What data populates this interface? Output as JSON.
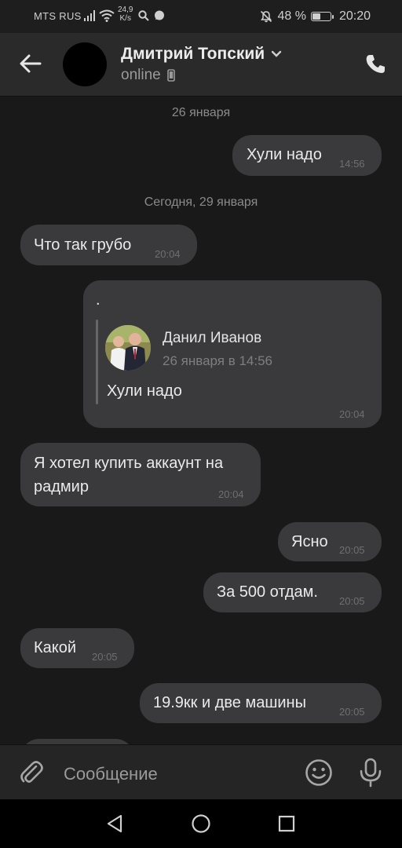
{
  "status_bar": {
    "carrier": "MTS RUS",
    "speed_value": "24,9",
    "speed_unit": "K/s",
    "battery": "48 %",
    "battery_level": 0.48,
    "time": "20:20"
  },
  "header": {
    "contact_name": "Дмитрий Топский",
    "presence": "online"
  },
  "chat": {
    "date_1": "26 января",
    "date_2": "Сегодня, 29 января",
    "messages": [
      {
        "text": "Хули надо",
        "time": "14:56",
        "side": "outgoing"
      },
      {
        "text": "Что так грубо",
        "time": "20:04",
        "side": "incoming"
      },
      {
        "text": ".",
        "time": "20:04",
        "side": "outgoing",
        "reply": {
          "author": "Данил Иванов",
          "date": "26 января в 14:56",
          "text": "Хули надо"
        }
      },
      {
        "line1": "Я хотел купить аккаунт на",
        "line2": "радмир",
        "time": "20:04",
        "side": "incoming"
      },
      {
        "text": "Ясно",
        "time": "20:05",
        "side": "outgoing"
      },
      {
        "text": "За 500 отдам.",
        "time": "20:05",
        "side": "outgoing"
      },
      {
        "text": "Какой",
        "time": "20:05",
        "side": "incoming"
      },
      {
        "text": "19.9кк и две машины",
        "time": "20:05",
        "side": "outgoing"
      }
    ]
  },
  "composer": {
    "placeholder": "Сообщение"
  },
  "colors": {
    "background": "#19191a",
    "bubble": "#3a3a3c",
    "header": "#2a2a2b"
  }
}
